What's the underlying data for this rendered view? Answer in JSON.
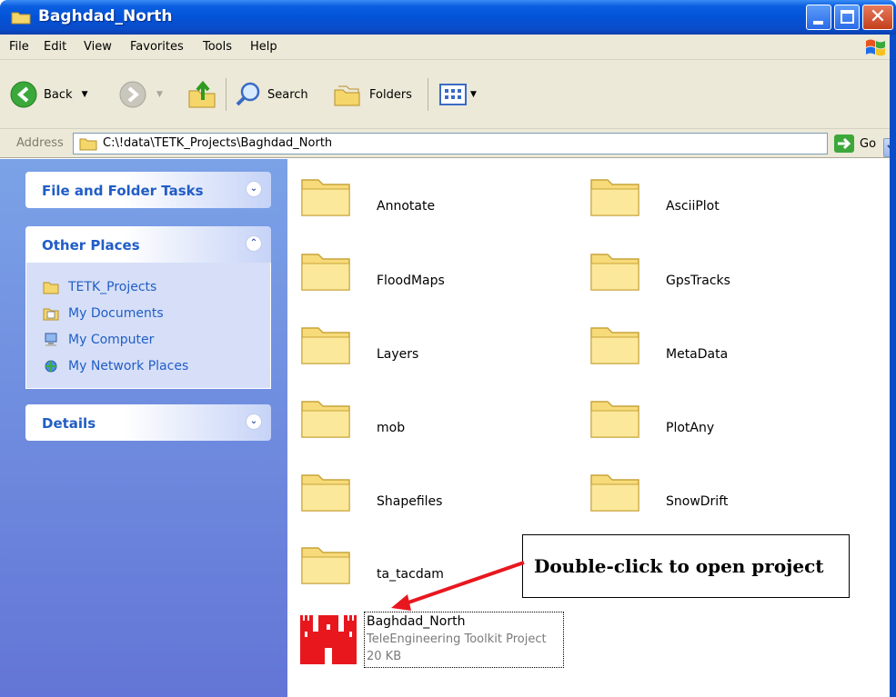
{
  "window": {
    "title": "Baghdad_North"
  },
  "menu": [
    "File",
    "Edit",
    "View",
    "Favorites",
    "Tools",
    "Help"
  ],
  "toolbar": {
    "back_label": "Back",
    "search_label": "Search",
    "folders_label": "Folders"
  },
  "address": {
    "label": "Address",
    "path": "C:\\!data\\TETK_Projects\\Baghdad_North",
    "go_label": "Go"
  },
  "taskpane": {
    "file_tasks_title": "File and Folder Tasks",
    "other_places_title": "Other Places",
    "other_places": [
      {
        "label": "TETK_Projects",
        "icon": "folder-icon"
      },
      {
        "label": "My Documents",
        "icon": "my-documents-icon"
      },
      {
        "label": "My Computer",
        "icon": "my-computer-icon"
      },
      {
        "label": "My Network Places",
        "icon": "network-places-icon"
      }
    ],
    "details_title": "Details"
  },
  "folders": [
    "Annotate",
    "AsciiPlot",
    "FloodMaps",
    "GpsTracks",
    "Layers",
    "MetaData",
    "mob",
    "PlotAny",
    "Shapefiles",
    "SnowDrift",
    "ta_tacdam"
  ],
  "project_file": {
    "name": "Baghdad_North",
    "type": "TeleEngineering Toolkit Project",
    "size": "20 KB"
  },
  "callout": {
    "text": "Double-click to open project",
    "color": "#e8171e"
  },
  "colors": {
    "title_bar": "#0353d8",
    "task_link": "#215dc6",
    "castle_red": "#e8171e"
  }
}
